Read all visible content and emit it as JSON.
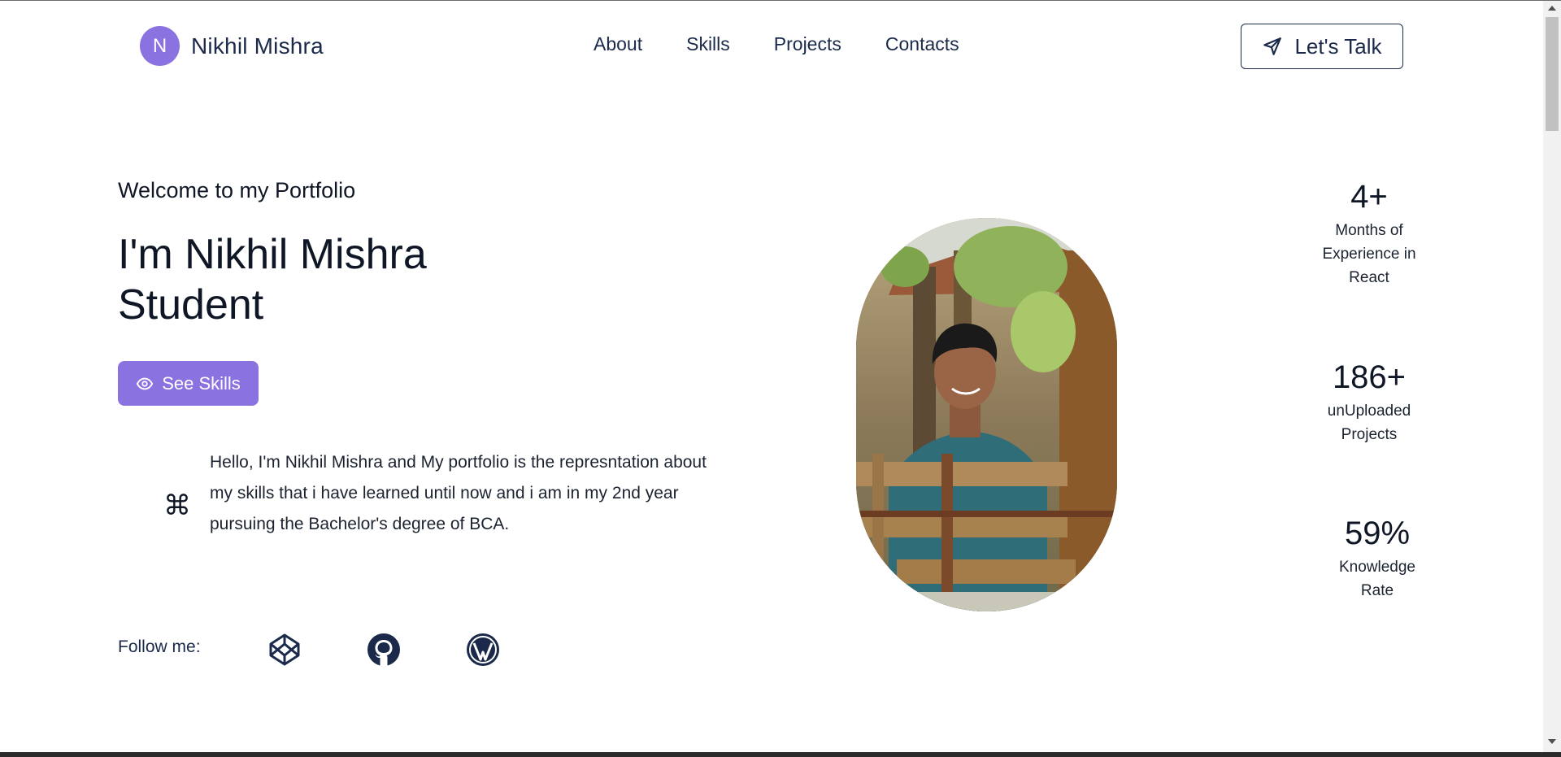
{
  "brand": {
    "initial": "N",
    "name": "Nikhil Mishra"
  },
  "nav": {
    "items": [
      "About",
      "Skills",
      "Projects",
      "Contacts"
    ]
  },
  "header": {
    "cta_label": "Let's Talk"
  },
  "hero": {
    "welcome": "Welcome to my Portfolio",
    "title_line1": "I'm Nikhil Mishra",
    "title_line2": "Student",
    "skills_button": "See Skills",
    "intro": "Hello, I'm Nikhil Mishra and My portfolio is the represntation about my skills that i have learned until now and i am in my 2nd year pursuing the Bachelor's degree of BCA."
  },
  "follow": {
    "label": "Follow me:",
    "icons": [
      "codepen-icon",
      "github-icon",
      "wordpress-icon"
    ]
  },
  "stats": [
    {
      "value": "4+",
      "line1": "Months of",
      "line2": "Experience in",
      "line3": "React"
    },
    {
      "value": "186+",
      "line1": "unUploaded",
      "line2": "Projects"
    },
    {
      "value": "59%",
      "line1": "Knowledge",
      "line2": "Rate"
    }
  ],
  "colors": {
    "accent": "#8a72e0",
    "navy": "#1b2a4a",
    "text": "#0f1726"
  }
}
